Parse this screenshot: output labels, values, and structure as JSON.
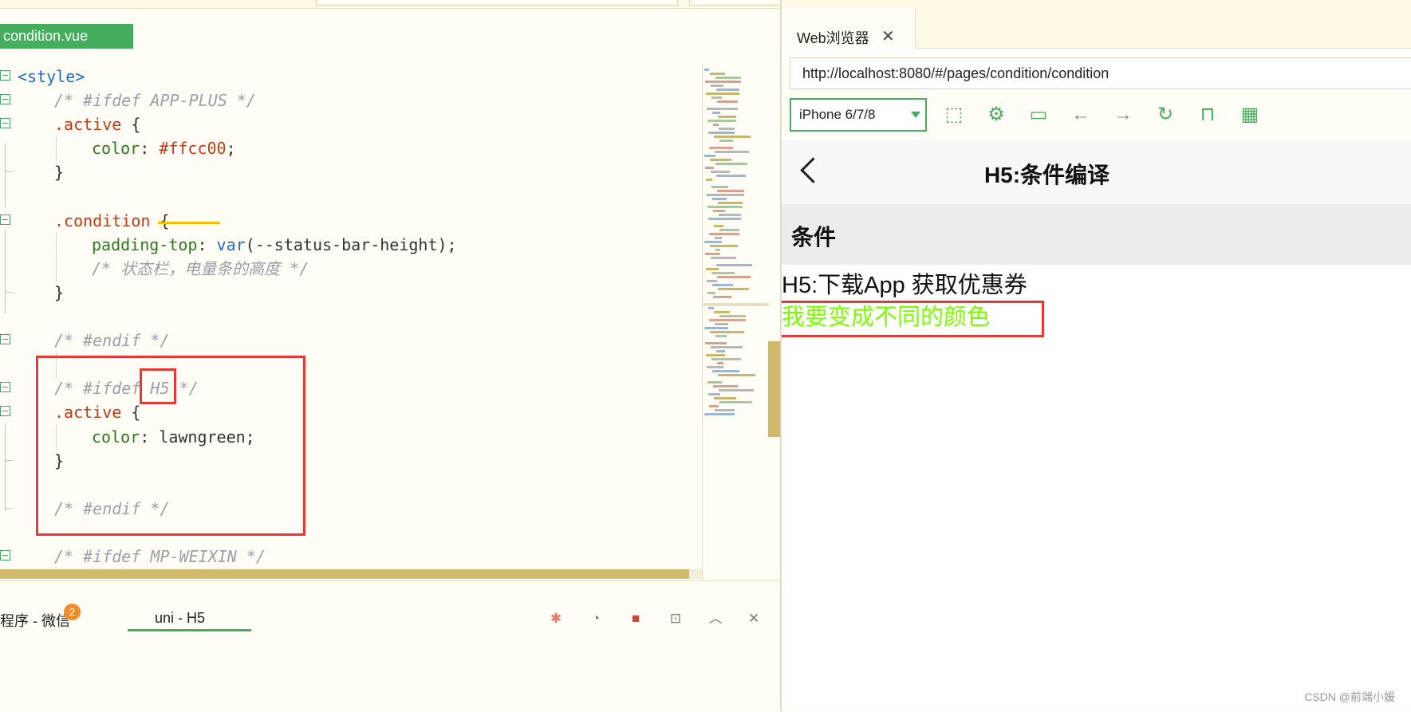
{
  "editor": {
    "file_tab": "condition.vue",
    "lines": [
      {
        "indent": 0,
        "fold": true,
        "parts": [
          {
            "c": "tag",
            "t": "<style>"
          }
        ]
      },
      {
        "indent": 1,
        "fold": true,
        "parts": [
          {
            "c": "cm",
            "t": "/* #ifdef APP-PLUS */"
          }
        ]
      },
      {
        "indent": 1,
        "fold": true,
        "parts": [
          {
            "c": "sel",
            "t": ".active"
          },
          {
            "c": "pn",
            "t": " {"
          }
        ]
      },
      {
        "indent": 2,
        "fold": false,
        "parts": [
          {
            "c": "prop",
            "t": "color"
          },
          {
            "c": "pn",
            "t": ": "
          },
          {
            "c": "hex",
            "t": "#ffcc00"
          },
          {
            "c": "pn",
            "t": ";"
          }
        ]
      },
      {
        "indent": 1,
        "fold": false,
        "parts": [
          {
            "c": "pn",
            "t": "}"
          }
        ]
      },
      {
        "indent": 0,
        "fold": false,
        "parts": []
      },
      {
        "indent": 1,
        "fold": true,
        "parts": [
          {
            "c": "sel",
            "t": ".condition"
          },
          {
            "c": "pn",
            "t": " {"
          }
        ]
      },
      {
        "indent": 2,
        "fold": false,
        "parts": [
          {
            "c": "prop",
            "t": "padding-top"
          },
          {
            "c": "pn",
            "t": ": "
          },
          {
            "c": "fn",
            "t": "var"
          },
          {
            "c": "pn",
            "t": "(--status-bar-height);"
          }
        ]
      },
      {
        "indent": 2,
        "fold": false,
        "parts": [
          {
            "c": "cm",
            "t": "/* 状态栏，电量条的高度 */"
          }
        ]
      },
      {
        "indent": 1,
        "fold": false,
        "parts": [
          {
            "c": "pn",
            "t": "}"
          }
        ]
      },
      {
        "indent": 0,
        "fold": false,
        "parts": []
      },
      {
        "indent": 1,
        "fold": true,
        "parts": [
          {
            "c": "cm",
            "t": "/* #endif */"
          }
        ]
      },
      {
        "indent": 0,
        "fold": false,
        "parts": []
      },
      {
        "indent": 1,
        "fold": true,
        "parts": [
          {
            "c": "cm",
            "t": "/* #ifdef H5 */"
          }
        ]
      },
      {
        "indent": 1,
        "fold": true,
        "parts": [
          {
            "c": "sel",
            "t": ".active"
          },
          {
            "c": "pn",
            "t": " {"
          }
        ]
      },
      {
        "indent": 2,
        "fold": false,
        "parts": [
          {
            "c": "prop",
            "t": "color"
          },
          {
            "c": "pn",
            "t": ": lawngreen;"
          }
        ]
      },
      {
        "indent": 1,
        "fold": false,
        "parts": [
          {
            "c": "pn",
            "t": "}"
          }
        ]
      },
      {
        "indent": 0,
        "fold": false,
        "parts": []
      },
      {
        "indent": 1,
        "fold": false,
        "parts": [
          {
            "c": "cm",
            "t": "/* #endif */"
          }
        ]
      },
      {
        "indent": 0,
        "fold": false,
        "parts": []
      },
      {
        "indent": 1,
        "fold": true,
        "parts": [
          {
            "c": "cm",
            "t": "/* #ifdef MP-WEIXIN */"
          }
        ]
      }
    ]
  },
  "bottom_bar": {
    "tab1_label": "小程序 - 微信",
    "tab1_visible": "小程序 - 微信",
    "tab1_badge": "2",
    "tab2_label": "uni - H5"
  },
  "browser": {
    "tab_label": "Web浏览器",
    "url": "http://localhost:8080/#/pages/condition/condition",
    "device": "iPhone 6/7/8"
  },
  "page": {
    "nav_title": "H5:条件编译",
    "section_title": "条件",
    "text_h5": "H5:下载App 获取优惠券",
    "text_colored": "我要变成不同的颜色",
    "text_colored_color": "#7cfc00"
  },
  "watermark": "CSDN @前端小媛",
  "colors": {
    "accent": "#44ae5e",
    "highlight_box": "#e53935",
    "underline": "#f2c200"
  }
}
